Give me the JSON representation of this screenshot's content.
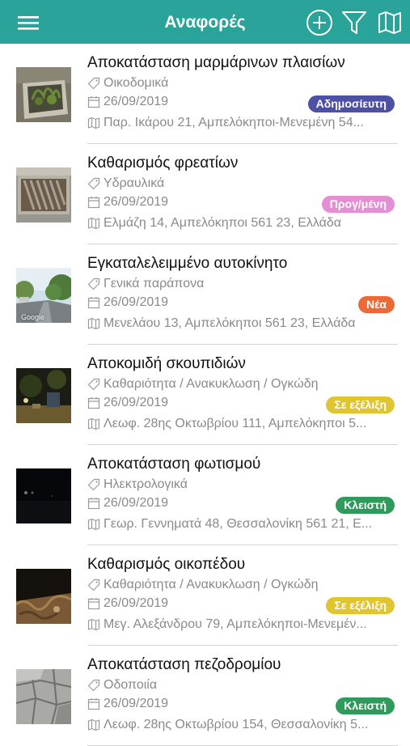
{
  "header": {
    "title": "Αναφορές",
    "icons": [
      "menu-icon",
      "add-circle-icon",
      "filter-icon",
      "map-icon"
    ],
    "color": "#2aa39a"
  },
  "reports": [
    {
      "title": "Αποκατάσταση μαρμάρινων πλαισίων",
      "category": "Οικοδομικά",
      "date": "26/09/2019",
      "address": "Παρ. Ικάρου 21, Αμπελόκηποι-Μενεμένη 54...",
      "status": "Αδημοσίευτη",
      "status_color": "#4e51a3",
      "thumb": "planter"
    },
    {
      "title": "Καθαρισμός φρεατίων",
      "category": "Υδραυλικά",
      "date": "26/09/2019",
      "address": "Ελμάζη 14, Αμπελόκηποι 561 23, Ελλάδα",
      "status": "Προγ/μένη",
      "status_color": "#e48fd4",
      "thumb": "grate"
    },
    {
      "title": "Εγκαταλελειμμένο αυτοκίνητο",
      "category": "Γενικά παράπονα",
      "date": "26/09/2019",
      "address": "Μενελάου 13, Αμπελόκηποι 561 23, Ελλάδα",
      "status": "Νέα",
      "status_color": "#ec6a35",
      "thumb": "street",
      "thumb_caption": "Google"
    },
    {
      "title": "Αποκομιδή σκουπιδιών",
      "category": "Καθαριότητα / Ανακυκλωση / Ογκώδη",
      "date": "26/09/2019",
      "address": "Λεωφ. 28ης Οκτωβρίου 111, Αμπελόκηποι 5...",
      "status": "Σε εξέλιξη",
      "status_color": "#e0c531",
      "thumb": "night-bin"
    },
    {
      "title": "Αποκατάσταση φωτισμού",
      "category": "Ηλεκτρολογικά",
      "date": "26/09/2019",
      "address": "Γεωρ. Γεννηματά 48, Θεσσαλονίκη 561 21, Ε...",
      "status": "Κλειστή",
      "status_color": "#2e9a5c",
      "thumb": "dark"
    },
    {
      "title": "Καθαρισμός οικοπέδου",
      "category": "Καθαριότητα / Ανακυκλωση / Ογκώδη",
      "date": "26/09/2019",
      "address": "Μεγ. Αλεξάνδρου 79, Αμπελόκηποι-Μενεμέν...",
      "status": "Σε εξέλιξη",
      "status_color": "#e0c531",
      "thumb": "lot"
    },
    {
      "title": "Αποκατάσταση πεζοδρομίου",
      "category": "Οδοποιία",
      "date": "26/09/2019",
      "address": "Λεωφ. 28ης Οκτωβρίου 154, Θεσσαλονίκη 5...",
      "status": "Κλειστή",
      "status_color": "#2e9a5c",
      "thumb": "sidewalk"
    }
  ]
}
